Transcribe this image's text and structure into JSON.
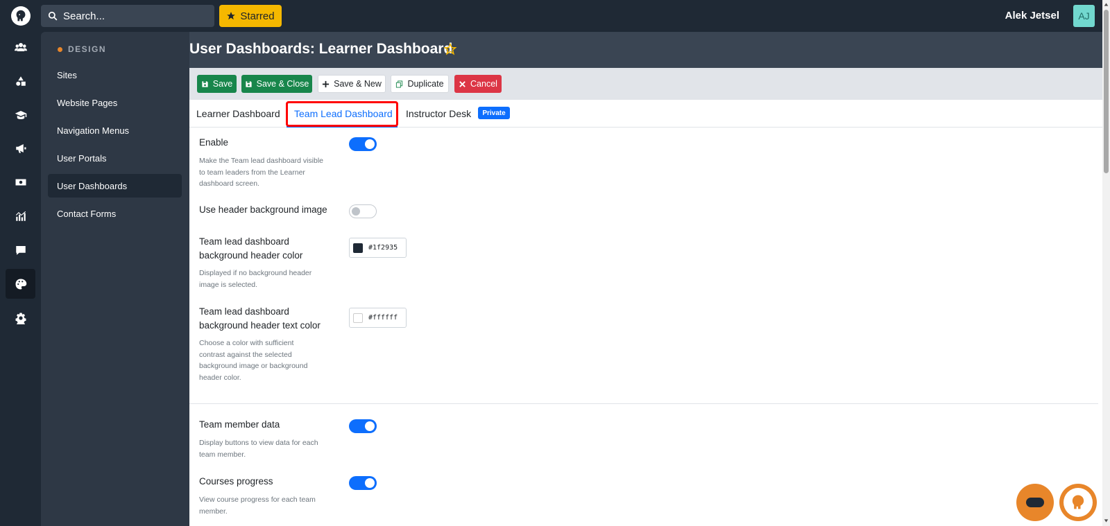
{
  "search": {
    "placeholder": "Search..."
  },
  "topbar": {
    "starred_label": "Starred",
    "user_name": "Alek Jetsel",
    "avatar_initials": "AJ"
  },
  "rail": {
    "icons": [
      "users-icon",
      "shapes-icon",
      "graduation-cap-icon",
      "megaphone-icon",
      "money-icon",
      "chart-icon",
      "comment-icon",
      "palette-icon",
      "gear-icon"
    ],
    "active": "palette-icon"
  },
  "sidebar": {
    "section_title": "DESIGN",
    "items": [
      {
        "label": "Sites"
      },
      {
        "label": "Website Pages"
      },
      {
        "label": "Navigation Menus"
      },
      {
        "label": "User Portals"
      },
      {
        "label": "User Dashboards"
      },
      {
        "label": "Contact Forms"
      }
    ],
    "active_item": "User Dashboards"
  },
  "page": {
    "title": "User Dashboards: Learner Dashboard"
  },
  "toolbar": {
    "save": "Save",
    "save_close": "Save & Close",
    "save_new": "Save & New",
    "duplicate": "Duplicate",
    "cancel": "Cancel"
  },
  "tabs": {
    "items": [
      {
        "label": "Learner Dashboard"
      },
      {
        "label": "Team Lead Dashboard"
      },
      {
        "label": "Instructor Desk"
      }
    ],
    "active": "Team Lead Dashboard",
    "private_badge": "Private"
  },
  "fields": {
    "enable": {
      "label": "Enable",
      "help_lines": [
        "Make the Team lead dashboard visible",
        "to team leaders from the Learner",
        "dashboard screen."
      ],
      "value": true
    },
    "header_bg_image": {
      "label": "Use header background image",
      "value": false
    },
    "header_bg_color": {
      "label_lines": [
        "Team lead dashboard",
        "background header color"
      ],
      "help_lines": [
        "Displayed if no background header",
        "image is selected."
      ],
      "value": "#1f2935"
    },
    "header_text_color": {
      "label_lines": [
        "Team lead dashboard",
        "background header text color"
      ],
      "help_lines": [
        "Choose a color with sufficient",
        "contrast against the selected",
        "background image or background",
        "header color."
      ],
      "value": "#ffffff"
    },
    "team_member_data": {
      "label": "Team member data",
      "help_lines": [
        "Display buttons to view data for each",
        "team member."
      ],
      "value": true
    },
    "courses_progress": {
      "label": "Courses progress",
      "help_lines": [
        "View course progress for each team",
        "member."
      ],
      "value": true
    }
  },
  "colors": {
    "accent": "#0d6efd",
    "brand_orange": "#e8862a",
    "save_green": "#18864b",
    "cancel_red": "#dc3545",
    "starred_yellow": "#f5b800",
    "dark_bg": "#1f2935"
  }
}
